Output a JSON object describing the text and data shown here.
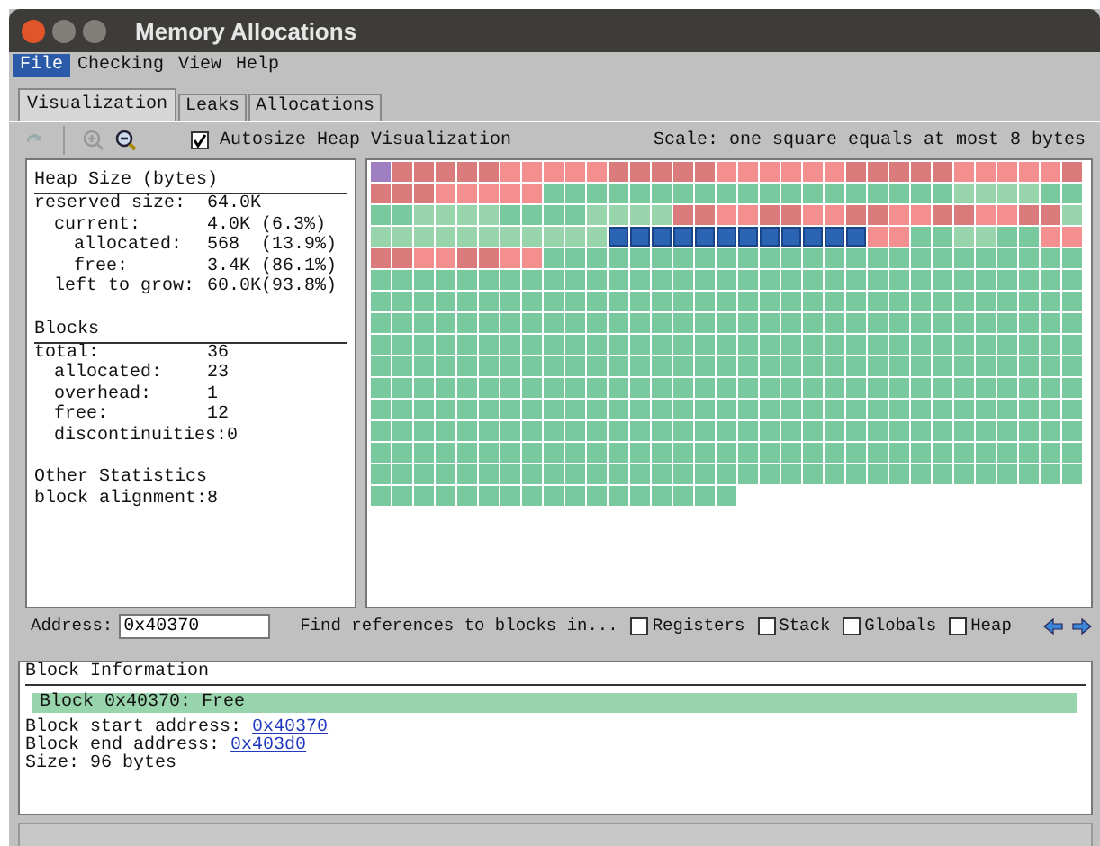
{
  "window": {
    "title": "Memory Allocations"
  },
  "menu": [
    {
      "label": "File",
      "selected": true
    },
    {
      "label": "Checking",
      "selected": false
    },
    {
      "label": "View",
      "selected": false
    },
    {
      "label": "Help",
      "selected": false
    }
  ],
  "tabs": [
    {
      "label": "Visualization",
      "selected": true
    },
    {
      "label": "Leaks",
      "selected": false
    },
    {
      "label": "Allocations",
      "selected": false
    }
  ],
  "toolbar": {
    "autosize": {
      "label": "Autosize Heap Visualization",
      "checked": true
    },
    "scale": "Scale: one square equals at most 8 bytes"
  },
  "stats": [
    {
      "title": "Heap Size (bytes)",
      "underlined": true,
      "rows": [
        {
          "label": "reserved size:",
          "value": "64.0K",
          "children": [
            {
              "label": "current:",
              "value": "4.0K (6.3%)",
              "children": [
                {
                  "label": "allocated:",
                  "value": "568  (13.9%)"
                },
                {
                  "label": "free:",
                  "value": "3.4K (86.1%)"
                }
              ]
            },
            {
              "label": "left to grow:",
              "value": "60.0K(93.8%)"
            }
          ]
        }
      ]
    },
    {
      "title": "Blocks",
      "underlined": true,
      "rows": [
        {
          "label": "total:",
          "value": "36",
          "children": [
            {
              "label": "allocated:",
              "value": "23"
            },
            {
              "label": "overhead:",
              "value": "1"
            },
            {
              "label": "free:",
              "value": "12"
            },
            {
              "label": "discontinuities:",
              "value": "0"
            }
          ]
        }
      ]
    },
    {
      "title": "Other Statistics",
      "underlined": false,
      "rows": [
        {
          "label": "block alignment:",
          "value": "8"
        }
      ]
    }
  ],
  "heap": {
    "blocks": [
      {
        "color": "#9d7fc2",
        "selected": false
      },
      {
        "color": "#d97b7b",
        "selected": false
      },
      {
        "color": "#f48f8f",
        "selected": false
      },
      {
        "color": "#d97b7b",
        "selected": false
      },
      {
        "color": "#f48f8f",
        "selected": false
      },
      {
        "color": "#d97b7b",
        "selected": false
      },
      {
        "color": "#f48f8f",
        "selected": false
      },
      {
        "color": "#d97b7b",
        "selected": false
      },
      {
        "color": "#f48f8f",
        "selected": false
      },
      {
        "color": "#78c99e",
        "selected": false
      },
      {
        "color": "#98d4ac",
        "selected": false
      },
      {
        "color": "#78c99e",
        "selected": false
      },
      {
        "color": "#98d4ac",
        "selected": false
      },
      {
        "color": "#78c99e",
        "selected": false
      },
      {
        "color": "#98d4ac",
        "selected": false
      },
      {
        "color": "#d97b7b",
        "selected": false
      },
      {
        "color": "#f48f8f",
        "selected": false
      },
      {
        "color": "#d97b7b",
        "selected": false
      },
      {
        "color": "#f48f8f",
        "selected": false
      },
      {
        "color": "#d97b7b",
        "selected": false
      },
      {
        "color": "#f48f8f",
        "selected": false
      },
      {
        "color": "#d97b7b",
        "selected": false
      },
      {
        "color": "#f48f8f",
        "selected": false
      },
      {
        "color": "#d97b7b",
        "selected": false
      },
      {
        "color": "#98d4ac",
        "selected": false
      },
      {
        "color": "#2b64b3",
        "selected": true
      },
      {
        "color": "#f48f8f",
        "selected": false
      },
      {
        "color": "#78c99e",
        "selected": false
      },
      {
        "color": "#98d4ac",
        "selected": false
      },
      {
        "color": "#78c99e",
        "selected": false
      },
      {
        "color": "#f48f8f",
        "selected": false
      },
      {
        "color": "#d97b7b",
        "selected": false
      },
      {
        "color": "#f48f8f",
        "selected": false
      },
      {
        "color": "#d97b7b",
        "selected": false
      },
      {
        "color": "#f48f8f",
        "selected": false
      },
      {
        "color": "#78c99e",
        "selected": false
      }
    ]
  },
  "address": {
    "label": "Address:",
    "value": "0x40370"
  },
  "references": {
    "label": "Find references to blocks in...",
    "options": [
      {
        "label": "Registers",
        "checked": false
      },
      {
        "label": "Stack",
        "checked": false
      },
      {
        "label": "Globals",
        "checked": false
      },
      {
        "label": "Heap",
        "checked": false
      }
    ]
  },
  "block_info": {
    "title": "Block Information",
    "banner": {
      "text": "Block 0x40370: Free",
      "color": "#98d4ac"
    },
    "lines": [
      {
        "label": "Block start address:",
        "link": "0x40370"
      },
      {
        "label": "Block end address:",
        "link": "0x403d0"
      }
    ],
    "size": "Size: 96 bytes"
  }
}
